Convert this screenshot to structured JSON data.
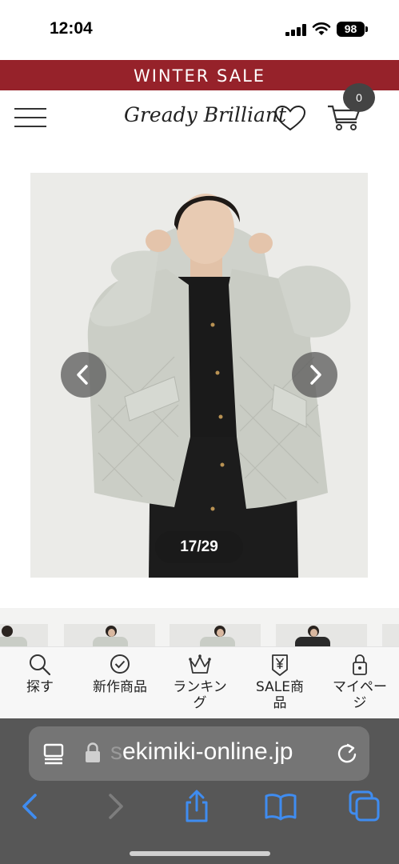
{
  "status_bar": {
    "time": "12:04",
    "battery": "98"
  },
  "banner": {
    "text": "WINTER SALE"
  },
  "header": {
    "menu_icon": "hamburger-icon",
    "logo_text": "Gready Brilliant",
    "logo_icon": "heart-icon",
    "cart_icon": "cart-icon",
    "cart_count": "0"
  },
  "gallery": {
    "counter": "17/29",
    "prev_icon": "chevron-left-icon",
    "next_icon": "chevron-right-icon"
  },
  "tabs": [
    {
      "label": "探す",
      "icon": "search-icon"
    },
    {
      "label": "新作商品",
      "icon": "check-circle-icon"
    },
    {
      "label": "ランキング",
      "label_line1": "ランキン",
      "label_line2": "グ",
      "icon": "crown-icon"
    },
    {
      "label": "SALE商品",
      "label_line1": "SALE商",
      "label_line2": "品",
      "icon": "yen-tag-icon"
    },
    {
      "label": "マイページ",
      "label_line1": "マイペー",
      "label_line2": "ジ",
      "icon": "lock-icon"
    }
  ],
  "browser": {
    "url": "ekimiki-online.jp",
    "url_partial_prefix": "s",
    "reader_icon": "reader-icon",
    "lock_icon": "lock-icon",
    "reload_icon": "reload-icon",
    "toolbar": [
      "back-icon",
      "forward-icon",
      "share-icon",
      "bookmarks-icon",
      "tabs-icon"
    ]
  },
  "colors": {
    "banner": "#96222a",
    "safari_bar": "#575757",
    "safari_blue": "#3f8cf0"
  }
}
